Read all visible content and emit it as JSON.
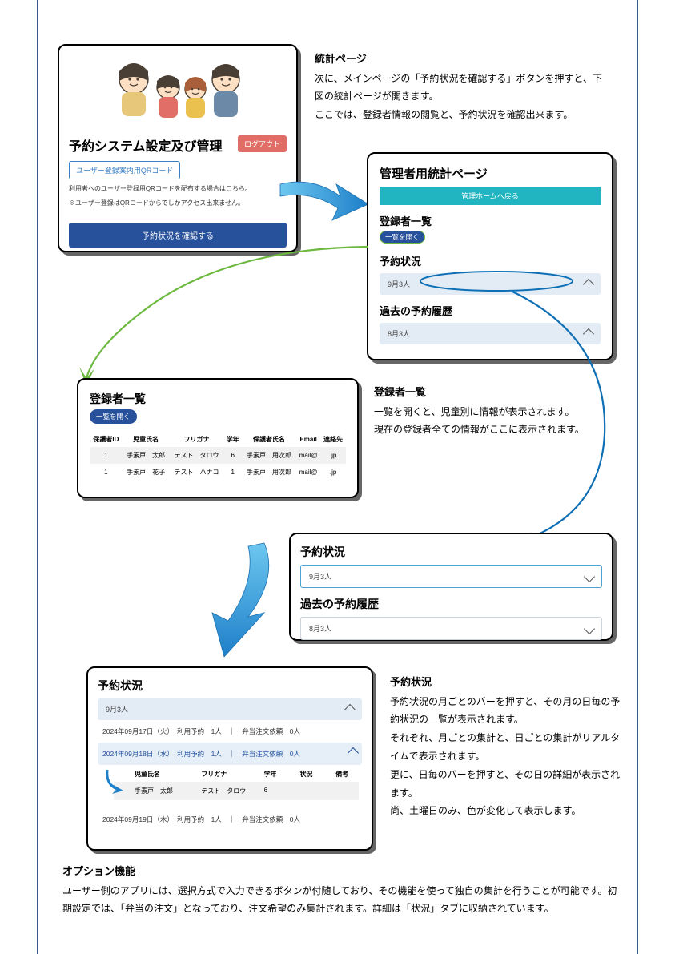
{
  "panel1": {
    "title": "予約システム設定及び管理",
    "logout": "ログアウト",
    "qr_button": "ユーザー登録案内用QRコード",
    "note1": "利用者へのユーザー登録用QRコードを配布する場合はこちら。",
    "note2": "※ユーザー登録はQRコードからでしかアクセス出来ません。",
    "main_button": "予約状況を確認する"
  },
  "desc1": {
    "heading": "統計ページ",
    "p1": "次に、メインページの「予約状況を確認する」ボタンを押すと、下図の統計ページが開きます。",
    "p2": "ここでは、登録者情報の閲覧と、予約状況を確認出来ます。"
  },
  "panel2": {
    "title": "管理者用統計ページ",
    "home_button": "管理ホームへ戻る",
    "reg_heading": "登録者一覧",
    "open_button": "一覧を開く",
    "resv_heading": "予約状況",
    "resv_bar": "9月3人",
    "hist_heading": "過去の予約履歴",
    "hist_bar": "8月3人"
  },
  "panel3": {
    "title": "登録者一覧",
    "open_button": "一覧を開く",
    "headers": [
      "保護者ID",
      "児童氏名",
      "フリガナ",
      "学年",
      "保護者氏名",
      "Email",
      "連絡先"
    ],
    "rows": [
      [
        "1",
        "手素戸　太郎",
        "テスト　タロウ",
        "6",
        "手素戸　用次郎",
        "mail@",
        ".jp"
      ],
      [
        "1",
        "手素戸　花子",
        "テスト　ハナコ",
        "1",
        "手素戸　用次郎",
        "mail@",
        ".jp"
      ]
    ]
  },
  "desc2": {
    "heading": "登録者一覧",
    "p1": "一覧を開くと、児童別に情報が表示されます。",
    "p2": "現在の登録者全ての情報がここに表示されます。"
  },
  "panel4": {
    "resv_heading": "予約状況",
    "resv_bar": "9月3人",
    "hist_heading": "過去の予約履歴",
    "hist_bar": "8月3人"
  },
  "panel5": {
    "title": "予約状況",
    "month_bar": "9月3人",
    "day1": "2024年09月17日（火）　利用予約　1人　｜　弁当注文依頼　0人",
    "day2": "2024年09月18日（水）　利用予約　1人　｜　弁当注文依頼　0人",
    "detail_headers": [
      "児童氏名",
      "フリガナ",
      "学年",
      "状況",
      "備考"
    ],
    "detail_row": [
      "手素戸　太郎",
      "テスト　タロウ",
      "6",
      "",
      ""
    ],
    "day3": "2024年09月19日（木）　利用予約　1人　｜　弁当注文依頼　0人"
  },
  "desc3": {
    "heading": "予約状況",
    "p1": "予約状況の月ごとのバーを押すと、その月の日毎の予約状況の一覧が表示されます。",
    "p2": "それぞれ、月ごとの集計と、日ごとの集計がリアルタイムで表示されます。",
    "p3": "更に、日毎のバーを押すと、その日の詳細が表示されます。",
    "p4": "尚、土曜日のみ、色が変化して表示します。"
  },
  "option": {
    "heading": "オプション機能",
    "body": "ユーザー側のアプリには、選択方式で入力できるボタンが付随しており、その機能を使って独自の集計を行うことが可能です。初期設定では、「弁当の注文」となっており、注文希望のみ集計されます。詳細は「状況」タブに収納されています。"
  }
}
